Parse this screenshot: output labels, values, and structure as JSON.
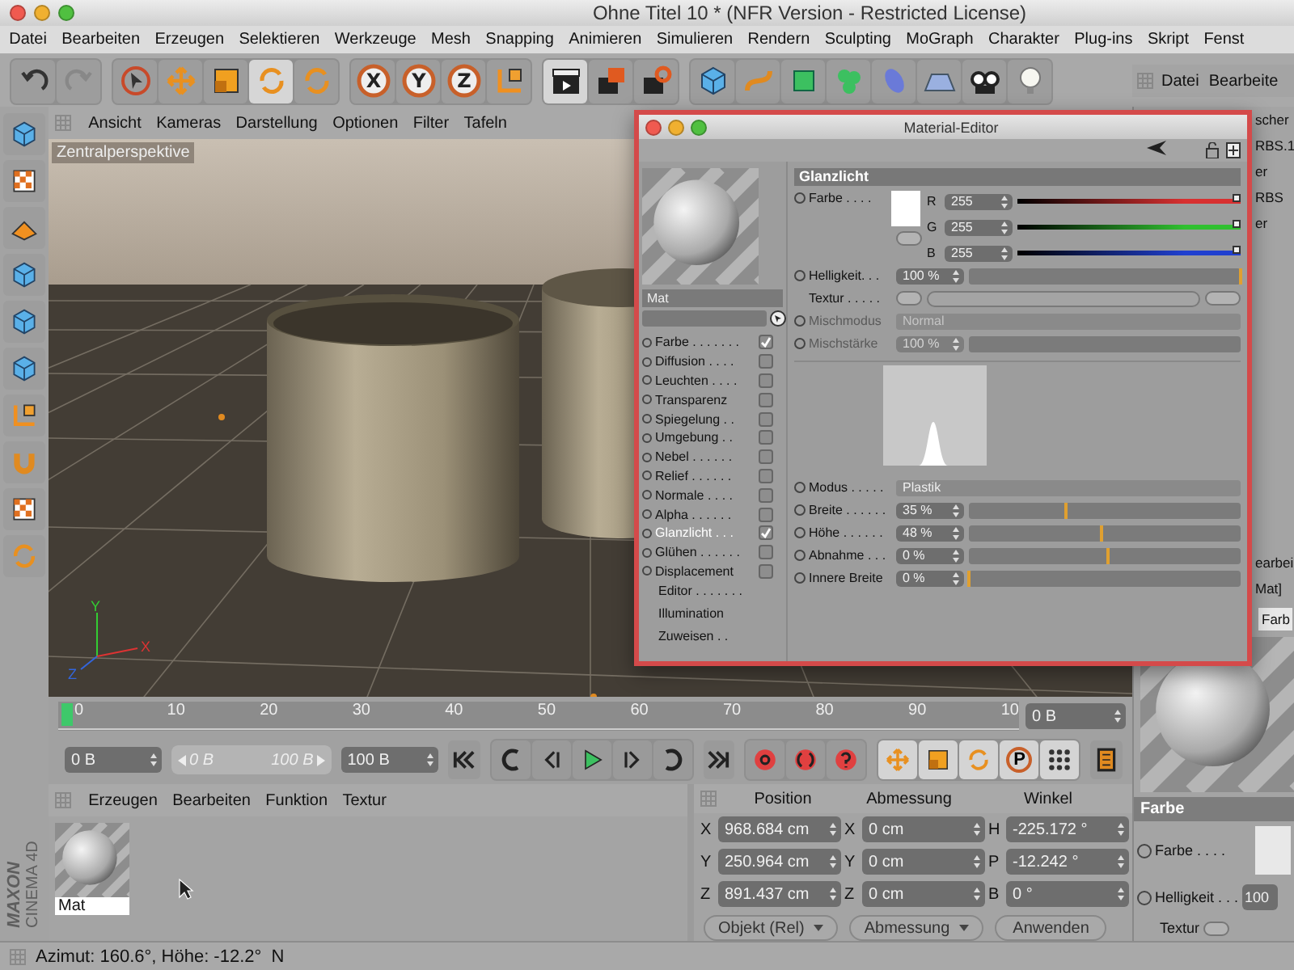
{
  "window": {
    "title": "Ohne Titel 10 * (NFR Version - Restricted License)"
  },
  "menu": [
    "Datei",
    "Bearbeiten",
    "Erzeugen",
    "Selektieren",
    "Werkzeuge",
    "Mesh",
    "Snapping",
    "Animieren",
    "Simulieren",
    "Rendern",
    "Sculpting",
    "MoGraph",
    "Charakter",
    "Plug-ins",
    "Skript",
    "Fenst"
  ],
  "toolbar": {
    "axis_buttons": [
      "X",
      "Y",
      "Z"
    ]
  },
  "right_panel": {
    "menu": [
      "Datei",
      "Bearbeite"
    ],
    "object_rows": [
      "scher",
      "RBS.1",
      "er",
      "RBS",
      "er"
    ],
    "attr_menu": "earbei",
    "attr_title": "Mat]",
    "tab": "Farb",
    "section": "Farbe",
    "params": [
      {
        "kind": "color",
        "label": "Farbe . . . ."
      },
      {
        "kind": "value",
        "label": "Helligkeit . . .",
        "value": "100"
      },
      {
        "kind": "texture",
        "label": "Textur"
      }
    ]
  },
  "viewport": {
    "menu": [
      "Ansicht",
      "Kameras",
      "Darstellung",
      "Optionen",
      "Filter",
      "Tafeln"
    ],
    "label": "Zentralperspektive",
    "axis_labels": [
      "Y",
      "X",
      "Z"
    ]
  },
  "timeline": {
    "ticks": [
      "0",
      "10",
      "20",
      "30",
      "40",
      "50",
      "60",
      "70",
      "80",
      "90",
      "10"
    ],
    "level": 0,
    "frame_field": "0 B"
  },
  "transport": {
    "start_field": "0 B",
    "range_start": "0 B",
    "range_end": "100 B",
    "level": 1,
    "end_field": "100 B",
    "key_label": "P"
  },
  "material_manager": {
    "menu": [
      "Erzeugen",
      "Bearbeiten",
      "Funktion",
      "Textur"
    ],
    "materials": [
      {
        "name": "Mat",
        "selected": true
      }
    ]
  },
  "coordinates": {
    "headers": [
      "Position",
      "Abmessung",
      "Winkel"
    ],
    "rows": [
      {
        "axis": "X",
        "position": "968.684 cm",
        "size_axis": "X",
        "size": "0 cm",
        "angle_axis": "H",
        "angle": "-225.172 °"
      },
      {
        "axis": "Y",
        "position": "250.964 cm",
        "size_axis": "Y",
        "size": "0 cm",
        "angle_axis": "P",
        "angle": "-12.242 °"
      },
      {
        "axis": "Z",
        "position": "891.437 cm",
        "size_axis": "Z",
        "size": "0 cm",
        "angle_axis": "B",
        "angle": "0 °"
      }
    ],
    "dropdowns": [
      "Objekt (Rel)",
      "Abmessung"
    ],
    "apply": "Anwenden"
  },
  "logo": {
    "brand": "MAXON",
    "product": "CINEMA 4D"
  },
  "status_bar": "Azimut: 160.6°, Höhe: -12.2°  N",
  "material_editor": {
    "title": "Material-Editor",
    "name": "Mat",
    "channels": [
      {
        "label": "Farbe . . . . . . .",
        "checked": true,
        "selected": false
      },
      {
        "label": "Diffusion . . . .",
        "checked": false,
        "selected": false
      },
      {
        "label": "Leuchten . . . .",
        "checked": false,
        "selected": false
      },
      {
        "label": "Transparenz",
        "checked": false,
        "selected": false
      },
      {
        "label": "Spiegelung . .",
        "checked": false,
        "selected": false
      },
      {
        "label": "Umgebung . .",
        "checked": false,
        "selected": false
      },
      {
        "label": "Nebel . . . . . .",
        "checked": false,
        "selected": false
      },
      {
        "label": "Relief . . . . . .",
        "checked": false,
        "selected": false
      },
      {
        "label": "Normale . . . .",
        "checked": false,
        "selected": false
      },
      {
        "label": "Alpha . . . . . .",
        "checked": false,
        "selected": false
      },
      {
        "label": "Glanzlicht . . .",
        "checked": true,
        "selected": true
      },
      {
        "label": "Glühen . . . . . .",
        "checked": false,
        "selected": false
      },
      {
        "label": "Displacement",
        "checked": false,
        "selected": false
      }
    ],
    "actions": [
      "Editor . . . . . . .",
      "Illumination",
      "Zuweisen . ."
    ],
    "section": "Glanzlicht",
    "color": {
      "label": "Farbe . . . .",
      "components": [
        {
          "label": "R",
          "value": "255",
          "level": 1,
          "color": "#d83030"
        },
        {
          "label": "G",
          "value": "255",
          "level": 1,
          "color": "#30c030"
        },
        {
          "label": "B",
          "value": "255",
          "level": 1,
          "color": "#2040d0"
        }
      ]
    },
    "params": [
      {
        "kind": "slider",
        "label": "Helligkeit. . .",
        "value": "100 %",
        "level": 1,
        "disabled": false
      },
      {
        "kind": "texture",
        "label": "Textur . . . . .",
        "disabled": false
      },
      {
        "kind": "dropdown",
        "label": "Mischmodus",
        "value": "Normal",
        "disabled": true
      },
      {
        "kind": "slider",
        "label": "Mischstärke",
        "value": "100 %",
        "disabled": true
      },
      {
        "kind": "curve"
      },
      {
        "kind": "dropdown",
        "label": "Modus . . . . .",
        "value": "Plastik",
        "disabled": false
      },
      {
        "kind": "slider",
        "label": "Breite . . . . . .",
        "value": "35 %",
        "level": 0.36,
        "disabled": false
      },
      {
        "kind": "slider",
        "label": "Höhe . . . . . .",
        "value": "48 %",
        "level": 0.49,
        "disabled": false
      },
      {
        "kind": "slider",
        "label": "Abnahme . . .",
        "value": "0 %",
        "level": 0.51,
        "disabled": false
      },
      {
        "kind": "slider",
        "label": "Innere Breite",
        "value": "0 %",
        "level": 0,
        "disabled": false
      }
    ]
  }
}
